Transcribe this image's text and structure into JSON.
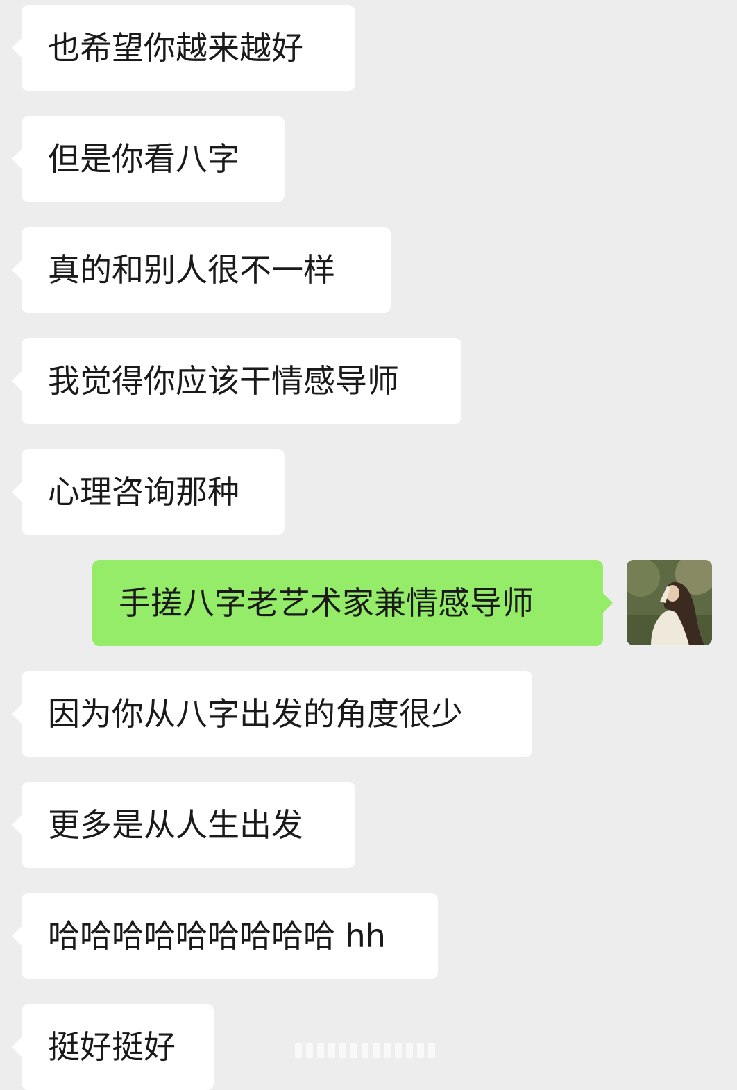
{
  "messages": [
    {
      "side": "in",
      "text": "也希望你越来越好"
    },
    {
      "side": "in",
      "text": "但是你看八字"
    },
    {
      "side": "in",
      "text": "真的和别人很不一样"
    },
    {
      "side": "in",
      "text": "我觉得你应该干情感导师"
    },
    {
      "side": "in",
      "text": "心理咨询那种"
    },
    {
      "side": "out",
      "text": "手搓八字老艺术家兼情感导师"
    },
    {
      "side": "in",
      "text": "因为你从八字出发的角度很少"
    },
    {
      "side": "in",
      "text": "更多是从人生出发"
    },
    {
      "side": "in",
      "text": "哈哈哈哈哈哈哈哈哈 hh"
    },
    {
      "side": "in",
      "text": "挺好挺好"
    }
  ],
  "colors": {
    "background": "#ededed",
    "incoming_bubble": "#ffffff",
    "outgoing_bubble": "#95ec69",
    "text": "#1a1a1a"
  },
  "avatar": {
    "icon": "user-avatar-photo"
  }
}
